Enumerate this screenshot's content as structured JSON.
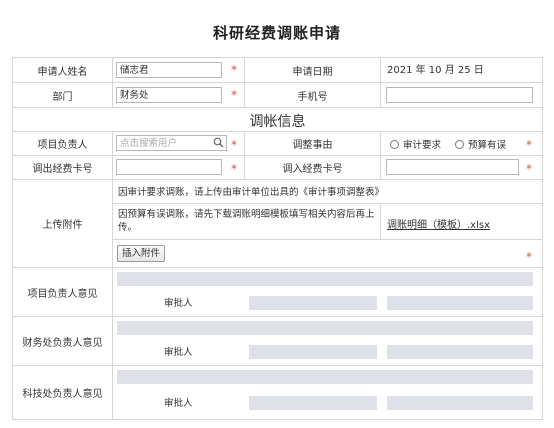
{
  "page": {
    "title": "科研经费调账申请"
  },
  "form": {
    "applicant_label": "申请人姓名",
    "applicant_value": "储志君",
    "date_label": "申请日期",
    "date_value": "2021 年 10 月 25 日",
    "dept_label": "部门",
    "dept_value": "财务处",
    "phone_label": "手机号",
    "phone_value": "",
    "section_title": "调帐信息",
    "project_leader_label": "项目负责人",
    "project_leader_placeholder": "点击搜索用户",
    "reason_label": "调整事由",
    "reason_options": [
      "审计要求",
      "预算有误"
    ],
    "out_card_label": "调出经费卡号",
    "in_card_label": "调入经费卡号",
    "upload_label": "上传附件",
    "upload_note_1": "因审计要求调账，请上传由审计单位出具的《审计事项调整表》",
    "upload_note_2": "因预算有误调账，请先下载调账明细模板填写相关内容后再上传。",
    "template_link": "调账明细（模板）.xlsx",
    "insert_attachment": "插入附件",
    "required_mark": "*"
  },
  "approvals": [
    {
      "label": "项目负责人意见",
      "approver_label": "审批人"
    },
    {
      "label": "财务处负责人意见",
      "approver_label": "审批人"
    },
    {
      "label": "科技处负责人意见",
      "approver_label": "审批人"
    }
  ],
  "colors": {
    "required": "#d9534f",
    "border": "#d6d6d6",
    "approval_bar": "#dfe1e8"
  }
}
